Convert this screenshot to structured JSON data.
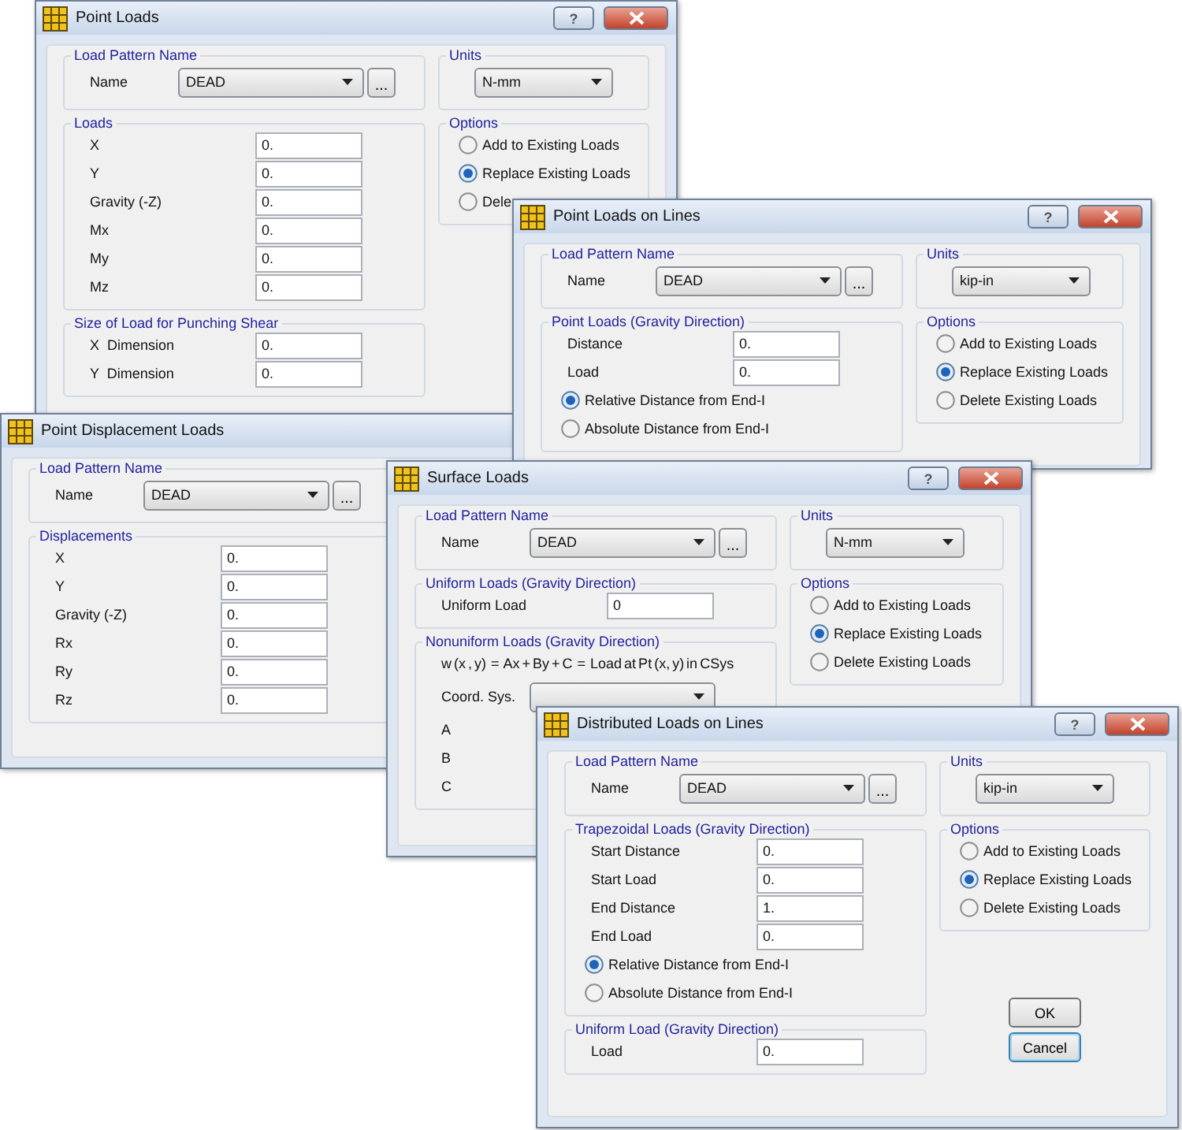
{
  "windows": [
    {
      "title": "Point Loads",
      "title_buttons": [
        {
          "kind": "help",
          "label": "?"
        },
        {
          "kind": "close"
        }
      ],
      "left": [
        {
          "legend": "Load Pattern Name",
          "items": [
            {
              "kind": "combo",
              "label": "Name",
              "value": "DEAD",
              "browse": "..."
            }
          ]
        },
        {
          "legend": "Loads",
          "items": [
            {
              "kind": "field",
              "label": "X",
              "value": "0."
            },
            {
              "kind": "field",
              "label": "Y",
              "value": "0."
            },
            {
              "kind": "field",
              "label": "Gravity (-Z)",
              "value": "0."
            },
            {
              "kind": "field",
              "label": "Mx",
              "value": "0."
            },
            {
              "kind": "field",
              "label": "My",
              "value": "0."
            },
            {
              "kind": "field",
              "label": "Mz",
              "value": "0."
            }
          ]
        },
        {
          "legend": "Size of Load for Punching Shear",
          "items": [
            {
              "kind": "field",
              "label": "X  Dimension",
              "value": "0."
            },
            {
              "kind": "field",
              "label": "Y  Dimension",
              "value": "0."
            }
          ]
        }
      ],
      "right": [
        {
          "legend": "Units",
          "items": [
            {
              "kind": "combo",
              "value": "N-mm"
            }
          ]
        },
        {
          "legend": "Options",
          "items": [
            {
              "kind": "radio",
              "label": "Add to Existing Loads",
              "selected": false
            },
            {
              "kind": "radio",
              "label": "Replace Existing Loads",
              "selected": true
            },
            {
              "kind": "radio",
              "label": "Dele",
              "selected": false
            }
          ]
        }
      ]
    },
    {
      "title": "Point Loads on Lines",
      "title_buttons": [
        {
          "kind": "help",
          "label": "?"
        },
        {
          "kind": "close"
        }
      ],
      "left": [
        {
          "legend": "Load Pattern Name",
          "items": [
            {
              "kind": "combo",
              "label": "Name",
              "value": "DEAD",
              "browse": "..."
            }
          ]
        },
        {
          "legend": "Point Loads (Gravity Direction)",
          "items": [
            {
              "kind": "field",
              "label": "Distance",
              "value": "0."
            },
            {
              "kind": "field",
              "label": "Load",
              "value": "0."
            },
            {
              "kind": "radio",
              "label": "Relative Distance from End-I",
              "selected": true
            },
            {
              "kind": "radio",
              "label": "Absolute Distance from End-I",
              "selected": false
            }
          ]
        }
      ],
      "right": [
        {
          "legend": "Units",
          "items": [
            {
              "kind": "combo",
              "value": "kip-in"
            }
          ]
        },
        {
          "legend": "Options",
          "items": [
            {
              "kind": "radio",
              "label": "Add to Existing Loads",
              "selected": false
            },
            {
              "kind": "radio",
              "label": "Replace Existing Loads",
              "selected": true
            },
            {
              "kind": "radio",
              "label": "Delete Existing Loads",
              "selected": false
            }
          ]
        }
      ]
    },
    {
      "title": "Point Displacement Loads",
      "left": [
        {
          "legend": "Load Pattern Name",
          "items": [
            {
              "kind": "combo",
              "label": "Name",
              "value": "DEAD",
              "browse": "..."
            }
          ]
        },
        {
          "legend": "Displacements",
          "items": [
            {
              "kind": "field",
              "label": "X",
              "value": "0."
            },
            {
              "kind": "field",
              "label": "Y",
              "value": "0."
            },
            {
              "kind": "field",
              "label": "Gravity (-Z)",
              "value": "0."
            },
            {
              "kind": "field",
              "label": "Rx",
              "value": "0."
            },
            {
              "kind": "field",
              "label": "Ry",
              "value": "0."
            },
            {
              "kind": "field",
              "label": "Rz",
              "value": "0."
            }
          ]
        }
      ]
    },
    {
      "title": "Surface Loads",
      "title_buttons": [
        {
          "kind": "help",
          "label": "?"
        },
        {
          "kind": "close"
        }
      ],
      "left": [
        {
          "legend": "Load Pattern Name",
          "items": [
            {
              "kind": "combo",
              "label": "Name",
              "value": "DEAD",
              "browse": "..."
            }
          ]
        },
        {
          "legend": "Uniform Loads (Gravity Direction)",
          "items": [
            {
              "kind": "field",
              "label": "Uniform Load",
              "value": "0"
            }
          ]
        },
        {
          "legend": "Nonuniform Loads (Gravity Direction)",
          "items": [
            {
              "kind": "text",
              "text": "w (x , y)  =  Ax + By + C  =  Load at Pt (x, y) in CSys"
            },
            {
              "kind": "combo",
              "label": "Coord. Sys."
            },
            {
              "kind": "label",
              "label": "A"
            },
            {
              "kind": "label",
              "label": "B"
            },
            {
              "kind": "label",
              "label": "C"
            }
          ]
        }
      ],
      "right": [
        {
          "legend": "Units",
          "items": [
            {
              "kind": "combo",
              "value": "N-mm"
            }
          ]
        },
        {
          "legend": "Options",
          "items": [
            {
              "kind": "radio",
              "label": "Add to Existing Loads",
              "selected": false
            },
            {
              "kind": "radio",
              "label": "Replace Existing Loads",
              "selected": true
            },
            {
              "kind": "radio",
              "label": "Delete Existing Loads",
              "selected": false
            }
          ]
        }
      ]
    },
    {
      "title": "Distributed Loads on Lines",
      "title_buttons": [
        {
          "kind": "help",
          "label": "?"
        },
        {
          "kind": "close"
        }
      ],
      "left": [
        {
          "legend": "Load Pattern Name",
          "items": [
            {
              "kind": "combo",
              "label": "Name",
              "value": "DEAD",
              "browse": "..."
            }
          ]
        },
        {
          "legend": "Trapezoidal Loads (Gravity Direction)",
          "items": [
            {
              "kind": "field",
              "label": "Start Distance",
              "value": "0."
            },
            {
              "kind": "field",
              "label": "Start Load",
              "value": "0."
            },
            {
              "kind": "field",
              "label": "End Distance",
              "value": "1."
            },
            {
              "kind": "field",
              "label": "End Load",
              "value": "0."
            },
            {
              "kind": "radio",
              "label": "Relative Distance from End-I",
              "selected": true
            },
            {
              "kind": "radio",
              "label": "Absolute Distance from End-I",
              "selected": false
            }
          ]
        },
        {
          "legend": "Uniform Load  (Gravity Direction)",
          "items": [
            {
              "kind": "field",
              "label": "Load",
              "value": "0."
            }
          ]
        }
      ],
      "right": [
        {
          "legend": "Units",
          "items": [
            {
              "kind": "combo",
              "value": "kip-in"
            }
          ]
        },
        {
          "legend": "Options",
          "items": [
            {
              "kind": "radio",
              "label": "Add to Existing Loads",
              "selected": false
            },
            {
              "kind": "radio",
              "label": "Replace Existing Loads",
              "selected": true
            },
            {
              "kind": "radio",
              "label": "Delete Existing Loads",
              "selected": false
            }
          ]
        }
      ],
      "buttons": [
        {
          "label": "OK",
          "focused": false
        },
        {
          "label": "Cancel",
          "focused": true
        }
      ]
    }
  ]
}
